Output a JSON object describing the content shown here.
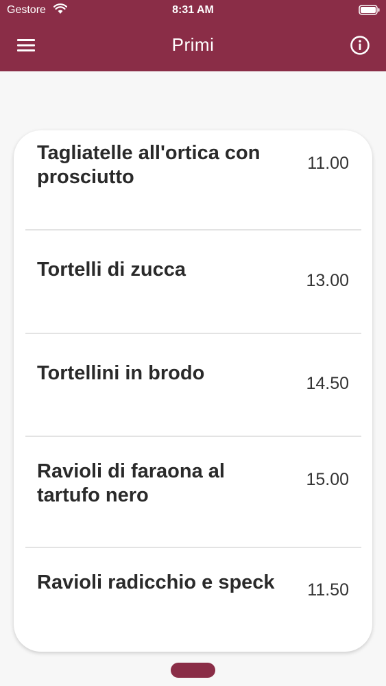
{
  "status_bar": {
    "carrier": "Gestore",
    "time": "8:31 AM",
    "wifi_icon": "wifi-icon",
    "battery_icon": "battery-icon"
  },
  "app_bar": {
    "title": "Primi",
    "menu_icon": "hamburger-menu-icon",
    "info_icon": "info-icon",
    "color": "#8a2d47"
  },
  "menu": {
    "items": [
      {
        "name": "Tagliatelle all'ortica con prosciutto",
        "price": "11.00"
      },
      {
        "name": "Tortelli di zucca",
        "price": "13.00"
      },
      {
        "name": "Tortellini in brodo",
        "price": "14.50"
      },
      {
        "name": "Ravioli di faraona al tartufo nero",
        "price": "15.00"
      },
      {
        "name": "Ravioli radicchio e speck",
        "price": "11.50"
      }
    ]
  }
}
